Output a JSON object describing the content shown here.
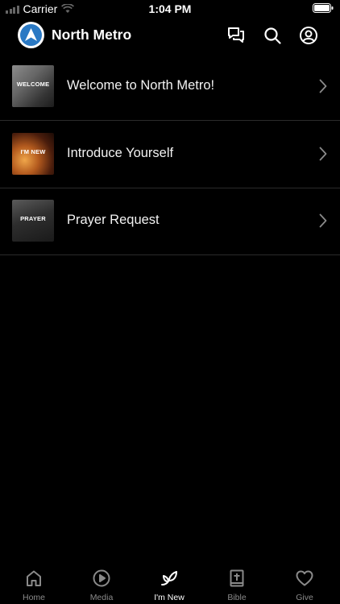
{
  "status_bar": {
    "carrier": "Carrier",
    "time": "1:04 PM"
  },
  "header": {
    "title": "North Metro",
    "brand_color": "#2a79c4"
  },
  "items": [
    {
      "label": "Welcome to North Metro!",
      "thumb_caption": "WELCOME"
    },
    {
      "label": "Introduce Yourself",
      "thumb_caption": "I'M NEW"
    },
    {
      "label": "Prayer Request",
      "thumb_caption": "PRAYER"
    }
  ],
  "tabs": [
    {
      "label": "Home",
      "icon": "home-icon"
    },
    {
      "label": "Media",
      "icon": "play-icon"
    },
    {
      "label": "I'm New",
      "icon": "leaf-icon"
    },
    {
      "label": "Bible",
      "icon": "bible-icon"
    },
    {
      "label": "Give",
      "icon": "heart-icon"
    }
  ],
  "active_tab": "I'm New"
}
